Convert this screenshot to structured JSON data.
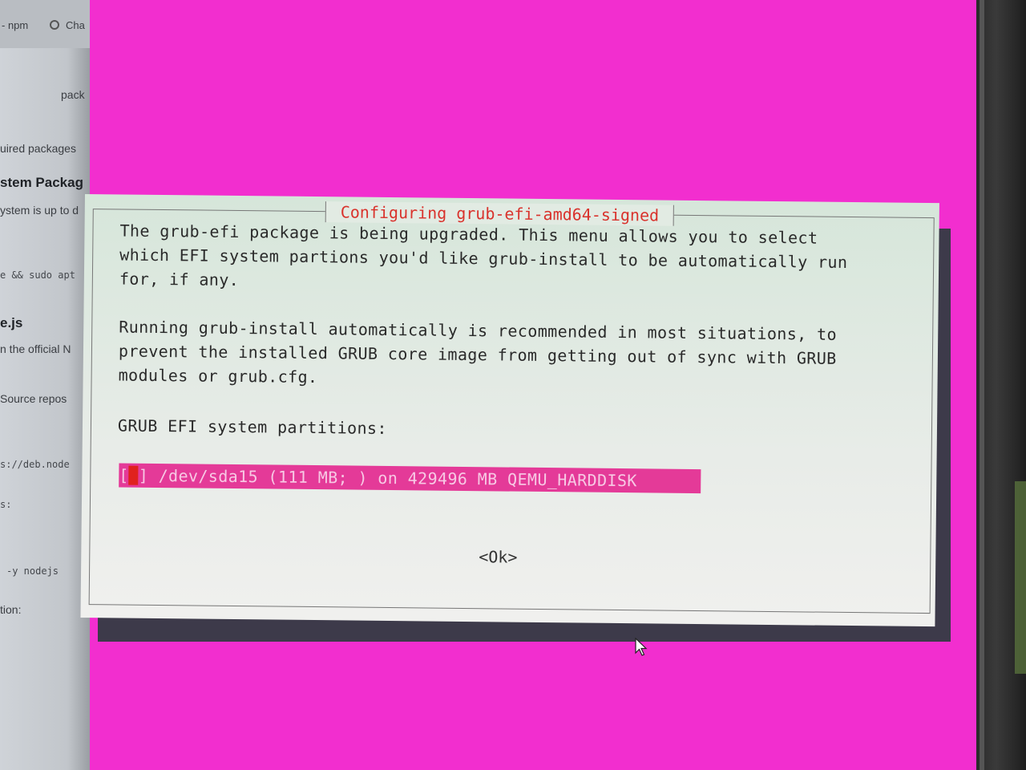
{
  "left_panel": {
    "tab_npm": "- npm",
    "tab_chat": "Cha",
    "line_pack": "pack",
    "line_required": "uired packages",
    "line_system_heading": "stem Packag",
    "line_up_to_date": "ystem is up to d",
    "line_command": "e && sudo apt",
    "line_nodejs_heading": "e.js",
    "line_official": "n the official N",
    "line_source": "Source repos",
    "line_deb_node": "s://deb.node",
    "line_s": "s:",
    "line_install": "-y nodejs",
    "line_tion": "tion:"
  },
  "dialog": {
    "title": "Configuring grub-efi-amd64-signed",
    "paragraph1": "The grub-efi package is being upgraded. This menu allows you to select\nwhich EFI system partions you'd like grub-install to be automatically run\nfor, if any.",
    "paragraph2": "Running grub-install automatically is recommended in most situations, to\nprevent the installed GRUB core image from getting out of sync with GRUB\nmodules or grub.cfg.",
    "list_label": "GRUB EFI system partitions:",
    "list_item_open": "[",
    "list_item_text": "] /dev/sda15 (111 MB; ) on 429496 MB QEMU_HARDDISK",
    "ok_label": "<Ok>"
  },
  "colors": {
    "screen_background": "#f22ecf",
    "dialog_background": "#e4ebe5",
    "title_color": "#d9322c",
    "selection_background": "#e43a98",
    "selection_text": "#f7c9e4",
    "cursor_color": "#e0221e"
  }
}
